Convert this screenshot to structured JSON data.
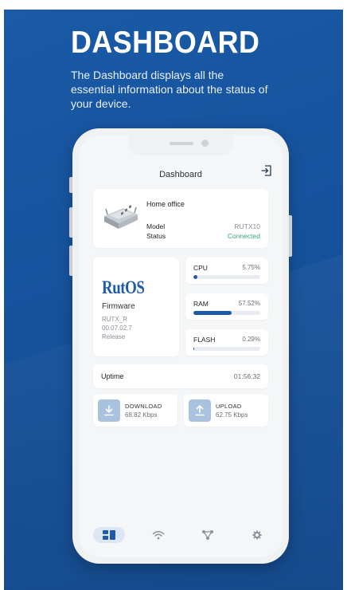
{
  "promo": {
    "title": "DASHBOARD",
    "subtitle": "The Dashboard displays all the essential information about the status of your device."
  },
  "app": {
    "title": "Dashboard",
    "device": {
      "name": "Home office",
      "model_label": "Model",
      "model_value": "RUTX10",
      "status_label": "Status",
      "status_value": "Connected"
    },
    "firmware": {
      "logo": "RutOS",
      "label": "Firmware",
      "lines": [
        "RUTX_R",
        "00.07.02.7",
        "Release"
      ]
    },
    "resources": [
      {
        "name": "CPU",
        "value": "5.75%",
        "fraction": 0.0575
      },
      {
        "name": "RAM",
        "value": "57.52%",
        "fraction": 0.5752
      },
      {
        "name": "FLASH",
        "value": "0.29%",
        "fraction": 0.0029
      }
    ],
    "uptime": {
      "label": "Uptime",
      "value": "01:56:32"
    },
    "download": {
      "label": "DOWNLOAD",
      "value": "68.82 Kbps"
    },
    "upload": {
      "label": "UPLOAD",
      "value": "62.75 Kbps"
    },
    "nav": [
      {
        "icon": "dashboard-icon",
        "active": true
      },
      {
        "icon": "wifi-icon",
        "active": false
      },
      {
        "icon": "topology-icon",
        "active": false
      },
      {
        "icon": "gear-icon",
        "active": false
      }
    ]
  },
  "colors": {
    "background": "#15509a",
    "accent": "#1e5aa8",
    "connected": "#3aa57a",
    "traffic_icon": "#a9c2df"
  }
}
